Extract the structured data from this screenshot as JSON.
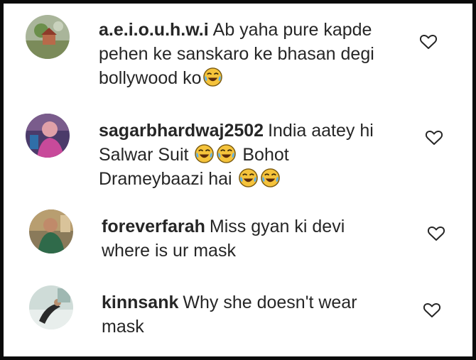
{
  "comments": [
    {
      "username": "a.e.i.o.u.h.w.i",
      "lines": [
        "Ab yaha pure kapde",
        "pehen ke sanskaro ke bhasan degi",
        "bollywood ko"
      ],
      "emoji_icon": "tears-of-joy-emoji",
      "like_icon": "heart-outline-icon"
    },
    {
      "username": "sagarbhardwaj2502",
      "lines": [
        "India aatey hi",
        "Salwar Suit",
        "Bohot",
        "Drameybaazi hai"
      ],
      "emoji_icon": "tears-of-joy-emoji",
      "like_icon": "heart-outline-icon"
    },
    {
      "username": "foreverfarah",
      "lines": [
        "Miss gyan ki devi",
        "where is ur mask"
      ],
      "like_icon": "heart-outline-icon"
    },
    {
      "username": "kinnsank",
      "lines": [
        "Why she doesn't wear",
        "mask"
      ],
      "like_icon": "heart-outline-icon"
    }
  ],
  "colors": {
    "text": "#262626",
    "frame": "#0a0a0a",
    "emoji_face": "#f5c33b"
  }
}
